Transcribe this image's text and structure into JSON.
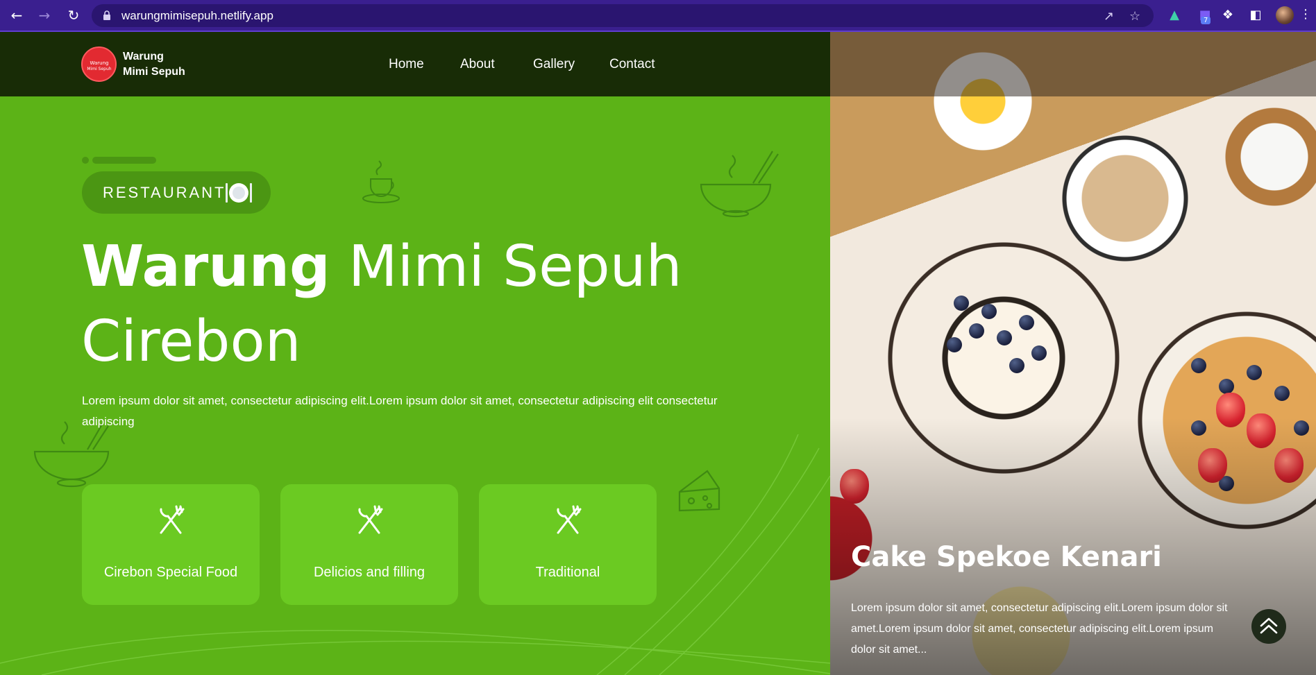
{
  "browser": {
    "url": "warungmimisepuh.netlify.app",
    "extension_badge": "7"
  },
  "brand": {
    "name_line1": "Warung",
    "name_line2": "Mimi Sepuh",
    "logo_text": "Warung Mimi Sepuh"
  },
  "nav": {
    "items": [
      {
        "label": "Home"
      },
      {
        "label": "About"
      },
      {
        "label": "Gallery"
      },
      {
        "label": "Contact"
      }
    ]
  },
  "hero": {
    "badge": "RESTAURANT",
    "badge_icon": "plate-cutlery-icon",
    "title_bold": "Warung",
    "title_rest": "Mimi Sepuh",
    "title_line2": "Cirebon",
    "description": "Lorem ipsum dolor sit amet, consectetur adipiscing elit.Lorem ipsum dolor sit amet, consectetur adipiscing elit consectetur adipiscing",
    "cards": [
      {
        "label": "Cirebon Special Food",
        "icon": "spoon-fork-icon"
      },
      {
        "label": "Delicios and filling",
        "icon": "spoon-fork-icon"
      },
      {
        "label": "Traditional",
        "icon": "spoon-fork-icon"
      }
    ]
  },
  "slide": {
    "title": "Cake Spekoe Kenari",
    "description": "Lorem ipsum dolor sit amet, consectetur adipiscing elit.Lorem ipsum dolor sit amet.Lorem ipsum dolor sit amet, consectetur adipiscing elit.Lorem ipsum dolor sit amet..."
  },
  "colors": {
    "hero_green": "#5cb317",
    "card_green": "#6bca22",
    "navbar_dark": "#182c06",
    "browser_chrome": "#3a1f8f"
  }
}
